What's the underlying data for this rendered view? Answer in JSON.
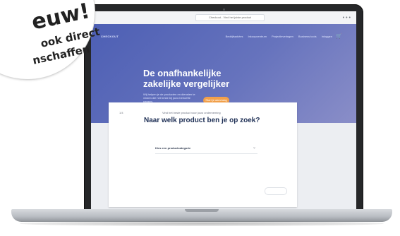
{
  "badge": {
    "title": "euw!",
    "line1": "ook direct",
    "line2": "nschaffen"
  },
  "browser": {
    "url": "Checkout - Vind het juiste product"
  },
  "site": {
    "brand": "CHECKOUT ",
    "nav": [
      "Bedrijfsadvies",
      "Inkoopcentrum",
      "Projectleveringen",
      "Business tools",
      "Inloggen"
    ],
    "headline": "De onafhankelijke\nzakelijke vergelijker",
    "subcopy": "Wij helpen je de producten en diensten te vinden die het beste bij jouw behoefte passen.",
    "cta_label": "Start je aanvraag"
  },
  "form": {
    "step_label": "1/4",
    "eyebrow": "Vind het beste product voor jouw onderneming",
    "question": "Naar welk product ben je op zoek?",
    "select_placeholder": "Kies een productcategorie"
  },
  "icons": {
    "cart": "cart-icon",
    "chevron": "chevron-down-icon",
    "browser_menu": "browser-menu-icon"
  }
}
